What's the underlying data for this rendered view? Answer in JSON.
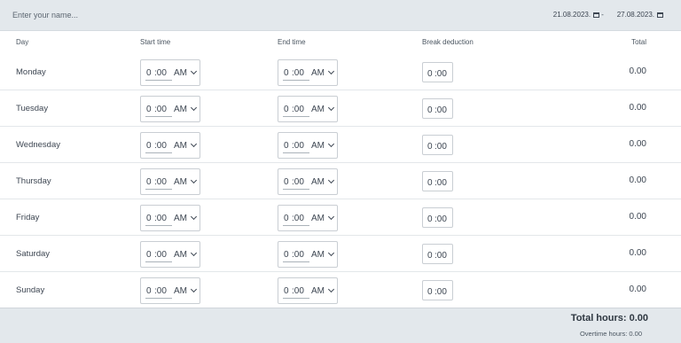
{
  "header": {
    "name_placeholder": "Enter your name...",
    "date_from": "21.08.2023.",
    "date_separator": "-",
    "date_to": "27.08.2023."
  },
  "columns": {
    "day": "Day",
    "start": "Start time",
    "end": "End time",
    "break": "Break deduction",
    "total": "Total"
  },
  "rows": [
    {
      "day": "Monday",
      "start": {
        "h": "0",
        "m": ":00",
        "ampm": "AM"
      },
      "end": {
        "h": "0",
        "m": ":00",
        "ampm": "AM"
      },
      "break": {
        "h": "0",
        "m": ":00"
      },
      "total": "0.00"
    },
    {
      "day": "Tuesday",
      "start": {
        "h": "0",
        "m": ":00",
        "ampm": "AM"
      },
      "end": {
        "h": "0",
        "m": ":00",
        "ampm": "AM"
      },
      "break": {
        "h": "0",
        "m": ":00"
      },
      "total": "0.00"
    },
    {
      "day": "Wednesday",
      "start": {
        "h": "0",
        "m": ":00",
        "ampm": "AM"
      },
      "end": {
        "h": "0",
        "m": ":00",
        "ampm": "AM"
      },
      "break": {
        "h": "0",
        "m": ":00"
      },
      "total": "0.00"
    },
    {
      "day": "Thursday",
      "start": {
        "h": "0",
        "m": ":00",
        "ampm": "AM"
      },
      "end": {
        "h": "0",
        "m": ":00",
        "ampm": "AM"
      },
      "break": {
        "h": "0",
        "m": ":00"
      },
      "total": "0.00"
    },
    {
      "day": "Friday",
      "start": {
        "h": "0",
        "m": ":00",
        "ampm": "AM"
      },
      "end": {
        "h": "0",
        "m": ":00",
        "ampm": "AM"
      },
      "break": {
        "h": "0",
        "m": ":00"
      },
      "total": "0.00"
    },
    {
      "day": "Saturday",
      "start": {
        "h": "0",
        "m": ":00",
        "ampm": "AM"
      },
      "end": {
        "h": "0",
        "m": ":00",
        "ampm": "AM"
      },
      "break": {
        "h": "0",
        "m": ":00"
      },
      "total": "0.00"
    },
    {
      "day": "Sunday",
      "start": {
        "h": "0",
        "m": ":00",
        "ampm": "AM"
      },
      "end": {
        "h": "0",
        "m": ":00",
        "ampm": "AM"
      },
      "break": {
        "h": "0",
        "m": ":00"
      },
      "total": "0.00"
    }
  ],
  "footer": {
    "total_hours": "Total hours: 0.00",
    "overtime_hours": "Overtime hours: 0.00"
  }
}
